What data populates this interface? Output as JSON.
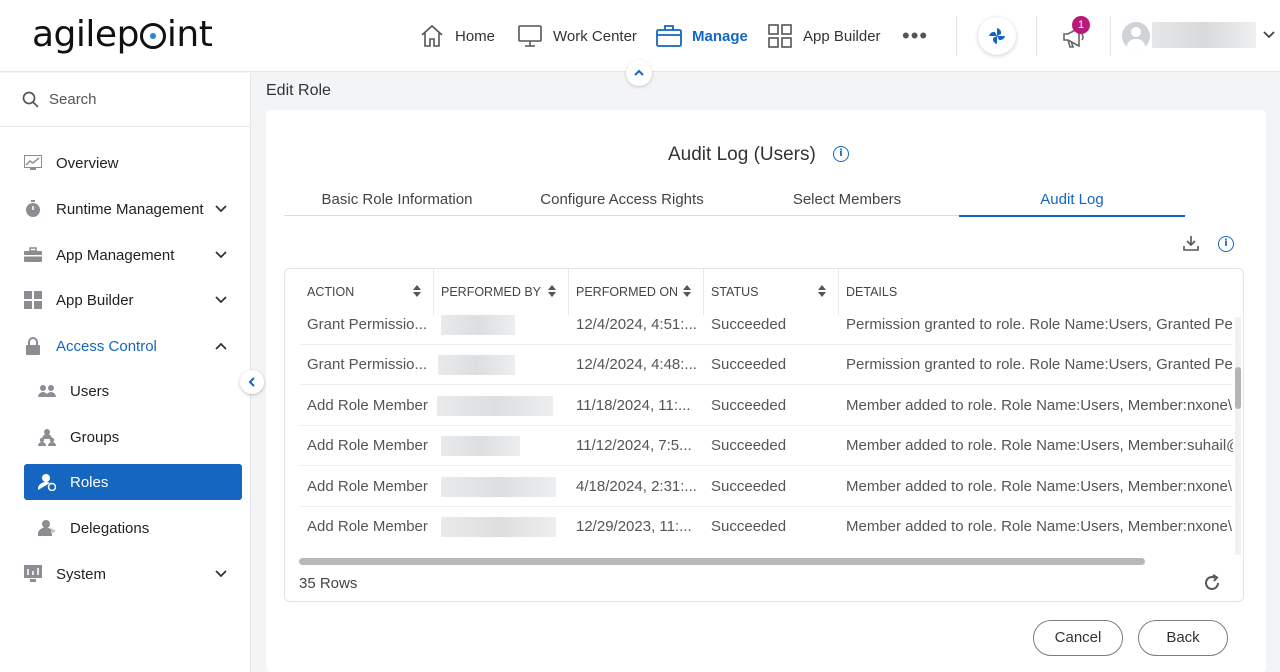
{
  "app": {
    "logo_text": "agilepoint"
  },
  "topnav": {
    "items": [
      {
        "label": "Home",
        "icon": "home-icon"
      },
      {
        "label": "Work Center",
        "icon": "monitor-icon"
      },
      {
        "label": "Manage",
        "icon": "briefcase-icon",
        "active": true
      },
      {
        "label": "App Builder",
        "icon": "grid-icon"
      }
    ],
    "more_label": "•••",
    "notification_count": "1",
    "accent_color": "#1466c0",
    "badge_color": "#b8197a"
  },
  "sidebar": {
    "search_placeholder": "Search",
    "items": [
      {
        "label": "Overview",
        "icon": "chart-icon"
      },
      {
        "label": "Runtime Management",
        "icon": "stopwatch-icon",
        "expandable": true
      },
      {
        "label": "App Management",
        "icon": "toolbox-icon",
        "expandable": true
      },
      {
        "label": "App Builder",
        "icon": "grid-icon",
        "expandable": true
      },
      {
        "label": "Access Control",
        "icon": "lock-icon",
        "expanded": true
      },
      {
        "label": "Users",
        "icon": "users-icon",
        "sub": true
      },
      {
        "label": "Groups",
        "icon": "groups-icon",
        "sub": true
      },
      {
        "label": "Roles",
        "icon": "roles-icon",
        "sub": true,
        "selected": true
      },
      {
        "label": "Delegations",
        "icon": "delegations-icon",
        "sub": true
      },
      {
        "label": "System",
        "icon": "system-icon",
        "expandable": true
      }
    ]
  },
  "page": {
    "title": "Edit Role"
  },
  "card": {
    "title": "Audit Log (Users)",
    "tabs": [
      {
        "label": "Basic Role Information"
      },
      {
        "label": "Configure Access Rights"
      },
      {
        "label": "Select Members"
      },
      {
        "label": "Audit Log",
        "active": true
      }
    ]
  },
  "table": {
    "columns": [
      "ACTION",
      "PERFORMED BY",
      "PERFORMED ON",
      "STATUS",
      "DETAILS"
    ],
    "rows": [
      {
        "action": "Grant Permissio...",
        "performed_on": "12/4/2024, 4:51:...",
        "status": "Succeeded",
        "details": "Permission granted to role. Role Name:Users, Granted Permis"
      },
      {
        "action": "Grant Permissio...",
        "performed_on": "12/4/2024, 4:48:...",
        "status": "Succeeded",
        "details": "Permission granted to role. Role Name:Users, Granted Permis"
      },
      {
        "action": "Add Role Member",
        "performed_on": "11/18/2024, 11:...",
        "status": "Succeeded",
        "details": "Member added to role. Role Name:Users, Member:nxone\\Do"
      },
      {
        "action": "Add Role Member",
        "performed_on": "11/12/2024, 7:5...",
        "status": "Succeeded",
        "details": "Member added to role. Role Name:Users, Member:suhail@s"
      },
      {
        "action": "Add Role Member",
        "performed_on": "4/18/2024, 2:31:...",
        "status": "Succeeded",
        "details": "Member added to role. Role Name:Users, Member:nxone\\Ka"
      },
      {
        "action": "Add Role Member",
        "performed_on": "12/29/2023, 11:...",
        "status": "Succeeded",
        "details": "Member added to role. Role Name:Users, Member:nxone\\Du"
      }
    ],
    "row_count": "35 Rows"
  },
  "buttons": {
    "cancel": "Cancel",
    "back": "Back"
  }
}
